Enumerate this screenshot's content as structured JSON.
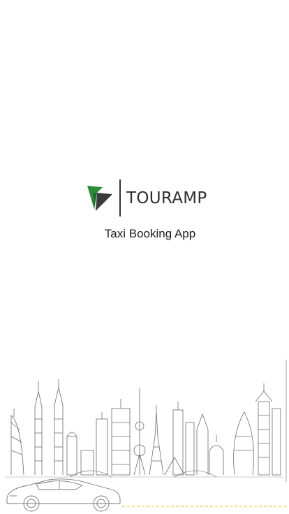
{
  "brand": {
    "name": "TOURAMP",
    "tagline": "Taxi Booking App",
    "colors": {
      "mark_green": "#2c8c3a",
      "mark_dark": "#3a3a3a",
      "text": "#2f2f2f",
      "dashed_road": "#f2c94c",
      "sketch": "#6b6b6b"
    }
  },
  "illustration": {
    "icon": "city-skyline-with-car",
    "car_icon": "sedan-sketch-icon"
  }
}
